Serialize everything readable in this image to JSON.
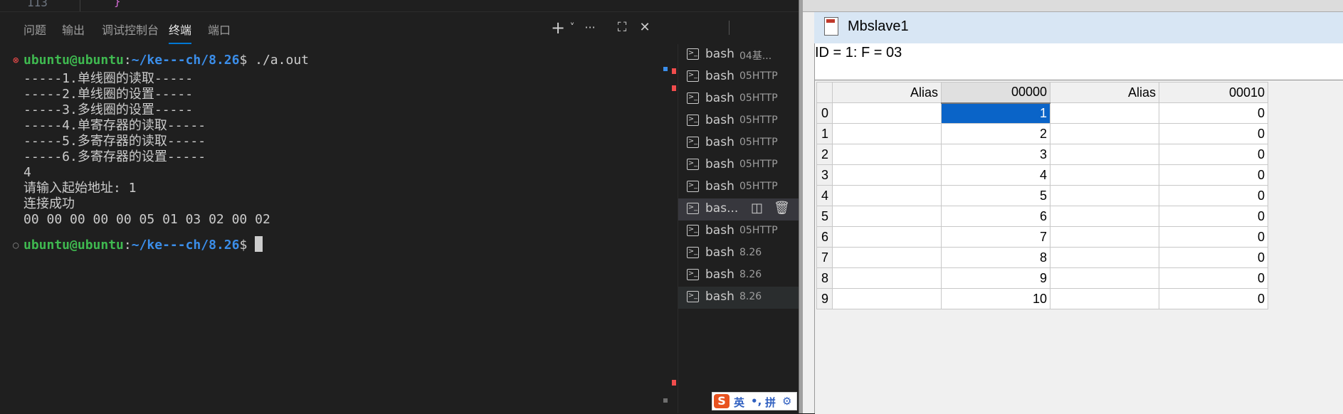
{
  "editor": {
    "line_number": "113",
    "brace": "}"
  },
  "panel": {
    "tabs": [
      "问题",
      "输出",
      "调试控制台",
      "终端",
      "端口"
    ],
    "active_tab": "终端",
    "actions": {
      "new_terminal": "+",
      "dropdown": "˅",
      "more": "···",
      "maximize": "⛶",
      "close": "✕"
    }
  },
  "terminal": {
    "prompt_user": "ubuntu@ubuntu",
    "prompt_sep": ":",
    "prompt_path": "~/ke---ch/8.26",
    "prompt_symbol": "$",
    "command": " ./a.out",
    "output_lines": [
      "-----1.单线圈的读取-----",
      "-----2.单线圈的设置-----",
      "-----3.多线圈的设置-----",
      "-----4.单寄存器的读取-----",
      "-----5.多寄存器的读取-----",
      "-----6.多寄存器的设置-----",
      "4",
      "请输入起始地址: 1",
      "连接成功",
      "00 00 00 00 00 05 01 03 02 00 02"
    ]
  },
  "terminal_list": [
    {
      "name": "bash",
      "desc": "04基..."
    },
    {
      "name": "bash",
      "desc": "05HTTP"
    },
    {
      "name": "bash",
      "desc": "05HTTP"
    },
    {
      "name": "bash",
      "desc": "05HTTP"
    },
    {
      "name": "bash",
      "desc": "05HTTP"
    },
    {
      "name": "bash",
      "desc": "05HTTP"
    },
    {
      "name": "bash",
      "desc": "05HTTP"
    },
    {
      "name": "bas...",
      "desc": ""
    },
    {
      "name": "bash",
      "desc": "05HTTP"
    },
    {
      "name": "bash",
      "desc": "8.26"
    },
    {
      "name": "bash",
      "desc": "8.26"
    },
    {
      "name": "bash",
      "desc": "8.26"
    }
  ],
  "ime": {
    "logo": "S",
    "lang": "英",
    "punct": "•,",
    "mode": "拼",
    "settings": "⚙"
  },
  "mbslave": {
    "title": "Mbslave1",
    "status": "ID = 1: F = 03",
    "columns": [
      "Alias",
      "00000",
      "Alias",
      "00010"
    ],
    "rows": [
      {
        "idx": "0",
        "v1": "1",
        "v2": "0"
      },
      {
        "idx": "1",
        "v1": "2",
        "v2": "0"
      },
      {
        "idx": "2",
        "v1": "3",
        "v2": "0"
      },
      {
        "idx": "3",
        "v1": "4",
        "v2": "0"
      },
      {
        "idx": "4",
        "v1": "5",
        "v2": "0"
      },
      {
        "idx": "5",
        "v1": "6",
        "v2": "0"
      },
      {
        "idx": "6",
        "v1": "7",
        "v2": "0"
      },
      {
        "idx": "7",
        "v1": "8",
        "v2": "0"
      },
      {
        "idx": "8",
        "v1": "9",
        "v2": "0"
      },
      {
        "idx": "9",
        "v1": "10",
        "v2": "0"
      }
    ]
  }
}
